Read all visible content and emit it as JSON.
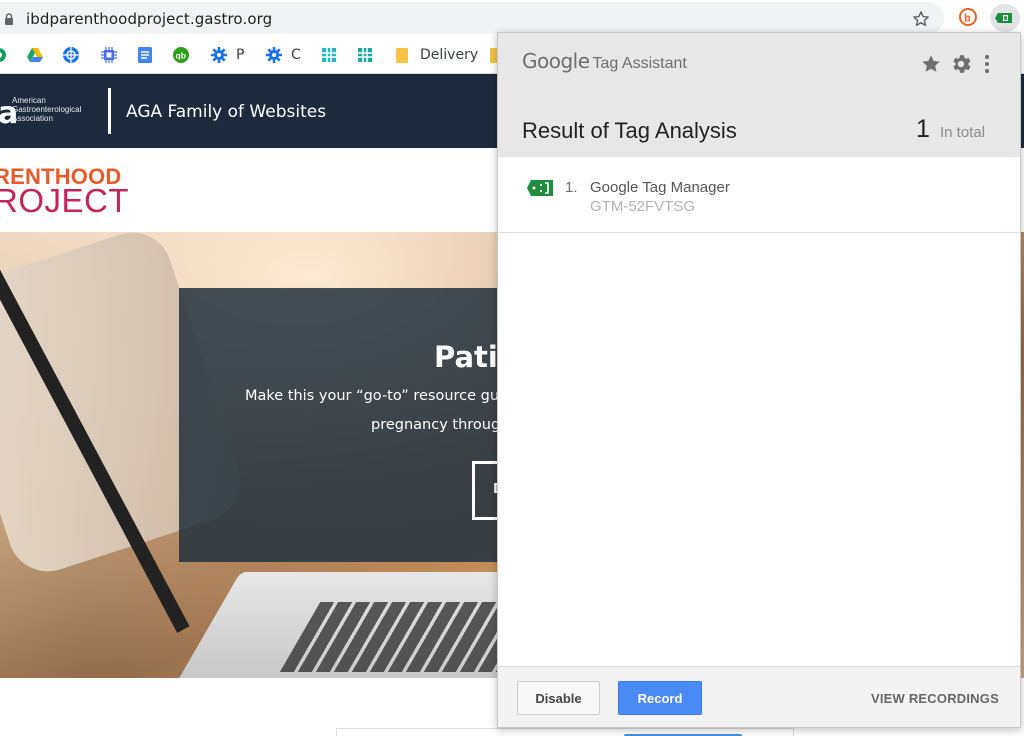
{
  "browser": {
    "url": "ibdparenthoodproject.gastro.org",
    "bookmarks": [
      {
        "icon": "green-circle-icon",
        "label": ""
      },
      {
        "icon": "google-drive-icon",
        "label": ""
      },
      {
        "icon": "network-globe-icon",
        "label": ""
      },
      {
        "icon": "chip-icon",
        "label": ""
      },
      {
        "icon": "docs-icon",
        "label": ""
      },
      {
        "icon": "quickbooks-icon",
        "label": ""
      },
      {
        "icon": "gear-blue-icon",
        "label": "P"
      },
      {
        "icon": "gear-blue-icon",
        "label": "C"
      },
      {
        "icon": "grid-teal-icon",
        "label": ""
      },
      {
        "icon": "grid-teal-icon",
        "label": ""
      },
      {
        "icon": "folder-icon",
        "label": "Delivery"
      }
    ],
    "colors": {
      "accent": "#f1f3f4"
    }
  },
  "site": {
    "org_letter": "a",
    "org_name": "American Gastroenterological Association",
    "family_title": "AGA Family of Websites",
    "logo_line1": "RENTHOOD",
    "logo_line2": "ROJECT",
    "hero_title": "Pati",
    "hero_line1": "Make this your “go-to” resource gu",
    "hero_line2": "pregnancy throug",
    "hero_button_fragment": "D"
  },
  "tag_assistant": {
    "brand_google": "Google",
    "brand_product": "Tag Assistant",
    "result_title": "Result of Tag Analysis",
    "total_count": "1",
    "total_label": "In total",
    "tags": [
      {
        "number": "1.",
        "name": "Google Tag Manager",
        "id": "GTM-52FVTSG",
        "icon": "tag-green-icon"
      }
    ],
    "buttons": {
      "disable": "Disable",
      "record": "Record",
      "view_recordings": "VIEW RECORDINGS"
    },
    "colors": {
      "record": "#4a8af4",
      "tag": "#1e8e3e",
      "header": "#e7e7e7"
    }
  }
}
